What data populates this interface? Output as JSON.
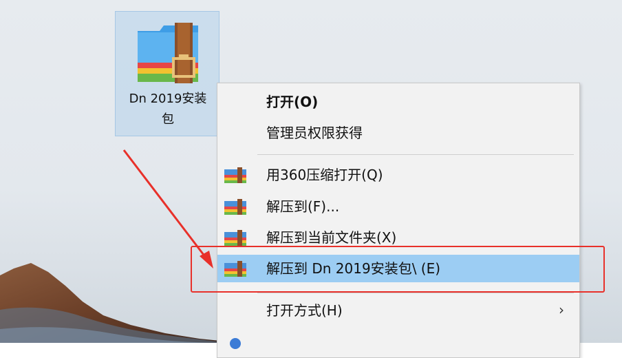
{
  "desktop_icon": {
    "label_line1": "Dn 2019安装",
    "label_line2": "包"
  },
  "context_menu": {
    "items": [
      {
        "label": "打开(O)",
        "bold": true,
        "icon": ""
      },
      {
        "label": "管理员权限获得",
        "icon": ""
      },
      {
        "label": "用360压缩打开(Q)",
        "icon": "archive-icon"
      },
      {
        "label": "解压到(F)...",
        "icon": "archive-icon"
      },
      {
        "label": "解压到当前文件夹(X)",
        "icon": "archive-icon"
      },
      {
        "label": "解压到 Dn 2019安装包\\ (E)",
        "icon": "archive-icon",
        "highlighted": true
      },
      {
        "label": "打开方式(H)",
        "icon": "",
        "submenu_arrow": "›"
      }
    ]
  },
  "colors": {
    "highlight": "#9ccdf3",
    "annotation_red": "#e8302a"
  }
}
